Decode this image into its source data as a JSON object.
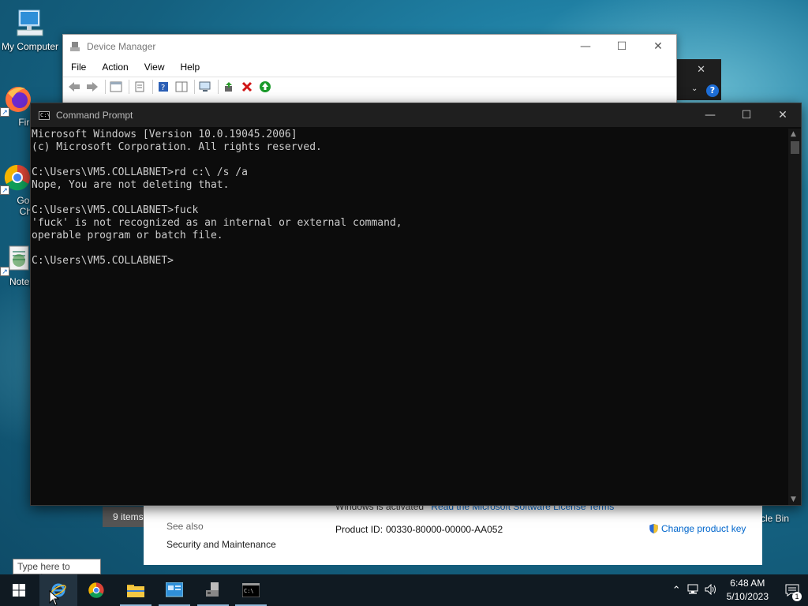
{
  "desktop": {
    "icons": [
      {
        "label": "My Computer"
      },
      {
        "label": "Fire"
      },
      {
        "label": "Goo\nChr"
      },
      {
        "label": "Notep"
      },
      {
        "label": "ycle Bin"
      }
    ]
  },
  "device_manager": {
    "title": "Device Manager",
    "menu": [
      "File",
      "Action",
      "View",
      "Help"
    ]
  },
  "command_prompt": {
    "title": "Command Prompt",
    "lines": [
      "Microsoft Windows [Version 10.0.19045.2006]",
      "(c) Microsoft Corporation. All rights reserved.",
      "",
      "C:\\Users\\VM5.COLLABNET>rd c:\\ /s /a",
      "Nope, You are not deleting that.",
      "",
      "C:\\Users\\VM5.COLLABNET>fuck",
      "'fuck' is not recognized as an internal or external command,",
      "operable program or batch file.",
      "",
      "C:\\Users\\VM5.COLLABNET>"
    ]
  },
  "system_panel": {
    "activation_text": "Windows is activated",
    "license_link": "Read the Microsoft Software License Terms",
    "see_also": "See also",
    "security_link": "Security and Maintenance",
    "product_id_label": "Product ID:",
    "product_id_value": "00330-80000-00000-AA052",
    "change_key": "Change product key"
  },
  "explorer": {
    "item_count": "9 items"
  },
  "taskbar": {
    "search_placeholder": "Type here to search",
    "time": "6:48 AM",
    "date": "5/10/2023",
    "notification_count": "1"
  }
}
